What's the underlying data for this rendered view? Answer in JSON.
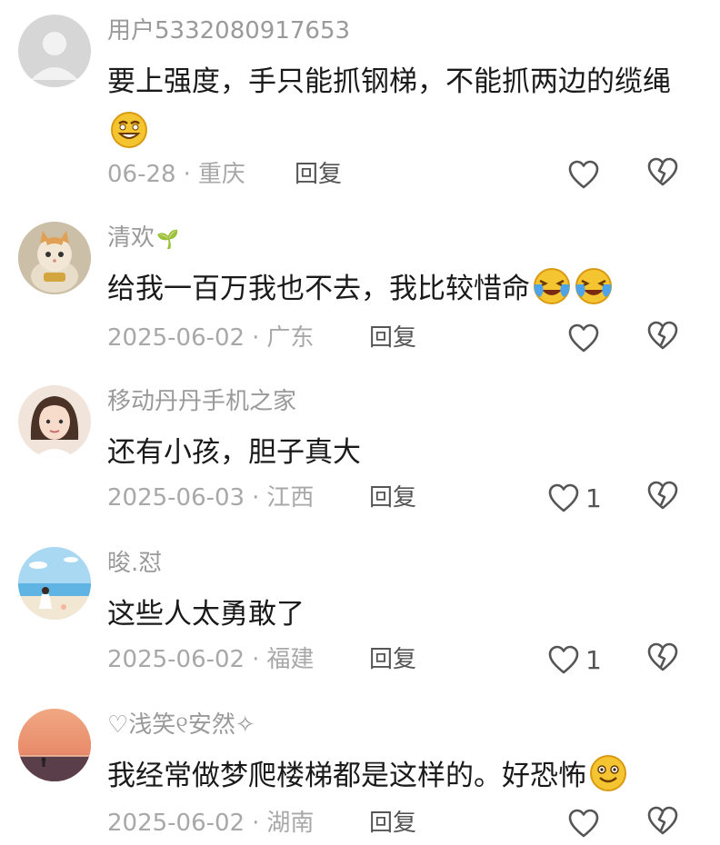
{
  "comments": [
    {
      "username": "用户5332080917653",
      "text": "要上强度，手只能抓钢梯，不能抓两边的缆绳",
      "emojis": [
        "grin-emoji"
      ],
      "date": "06-28",
      "location": "重庆",
      "reply_label": "回复",
      "likes": ""
    },
    {
      "username": "清欢",
      "username_deco": "🌱",
      "text": "给我一百万我也不去，我比较惜命",
      "emojis": [
        "laugh-cry-emoji",
        "laugh-cry-emoji"
      ],
      "date": "2025-06-02",
      "location": "广东",
      "reply_label": "回复",
      "likes": ""
    },
    {
      "username": "移动丹丹手机之家",
      "text": "还有小孩，胆子真大",
      "emojis": [],
      "date": "2025-06-03",
      "location": "江西",
      "reply_label": "回复",
      "likes": "1"
    },
    {
      "username": "晙.怼",
      "text": "这些人太勇敢了",
      "emojis": [],
      "date": "2025-06-02",
      "location": "福建",
      "reply_label": "回复",
      "likes": "1"
    },
    {
      "username": "♡浅笑୧安然✧",
      "text": "我经常做梦爬楼梯都是这样的。好恐怖",
      "emojis": [
        "smile-emoji"
      ],
      "date": "2025-06-02",
      "location": "湖南",
      "reply_label": "回复",
      "likes": ""
    }
  ],
  "separator": "·",
  "colors": {
    "text": "#1a1a1a",
    "muted": "#a8a8a8",
    "icon": "#555555",
    "emoji": "#f5c531"
  }
}
